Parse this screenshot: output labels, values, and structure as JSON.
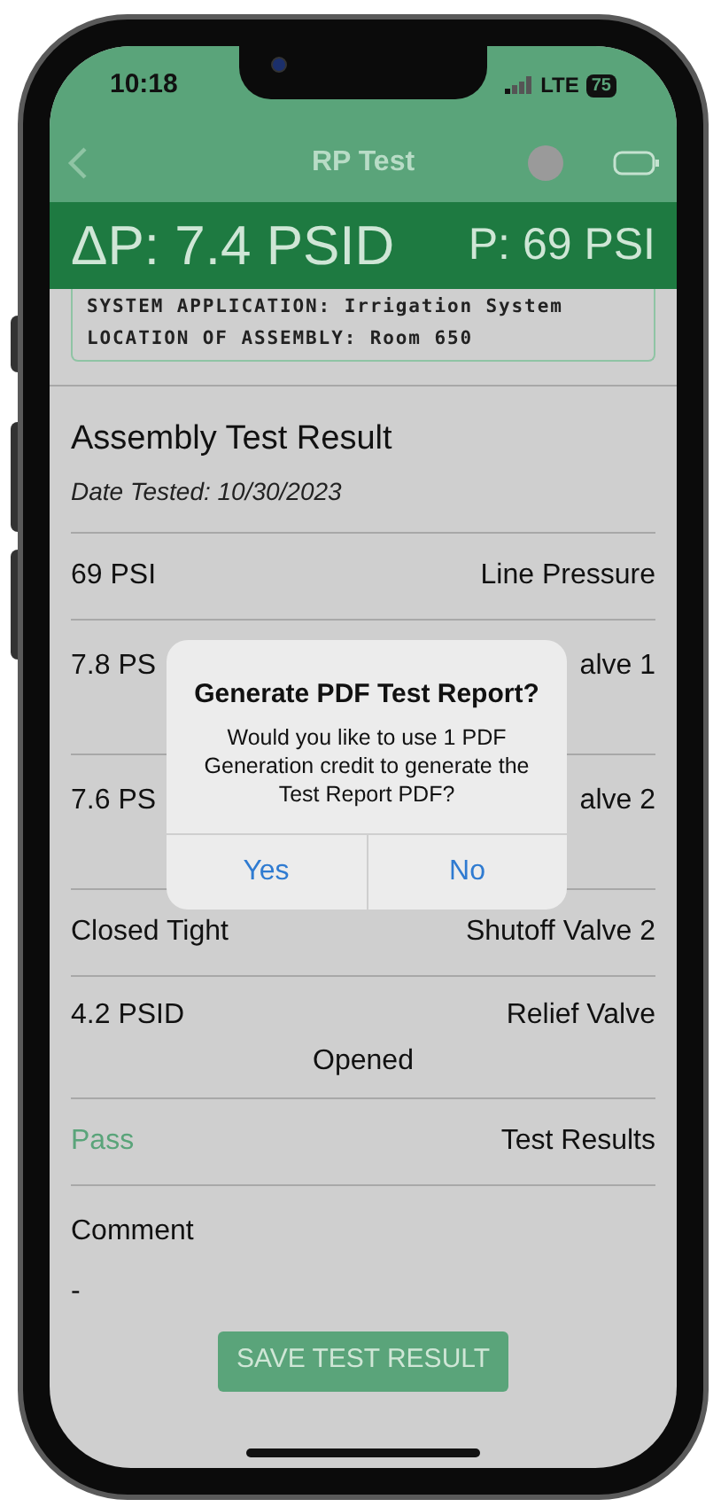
{
  "status_bar": {
    "time": "10:18",
    "network": "LTE",
    "battery": "75"
  },
  "nav": {
    "title": "RP Test"
  },
  "pressure_bar": {
    "differential": "ΔP: 7.4 PSID",
    "line": "P: 69 PSI"
  },
  "info_card": {
    "lines": [
      "SYSTEM APPLICATION: Irrigation System",
      "LOCATION OF ASSEMBLY: Room 650"
    ]
  },
  "result": {
    "title": "Assembly Test Result",
    "date": "Date Tested: 10/30/2023"
  },
  "rows": [
    {
      "kind": "plain",
      "value": "69 PSI",
      "label": "Line Pressure"
    },
    {
      "kind": "tall",
      "value": "7.8 PS",
      "label": "alve 1"
    },
    {
      "kind": "tall",
      "value": "7.6 PS",
      "label": "alve 2"
    },
    {
      "kind": "plain",
      "value": "Closed Tight",
      "label": "Shutoff Valve 2"
    },
    {
      "kind": "plain",
      "value": "4.2 PSID",
      "label": "Relief Valve",
      "note": "Opened"
    },
    {
      "kind": "result",
      "value": "Pass",
      "label": "Test Results"
    }
  ],
  "comment": {
    "label": "Comment",
    "value": "-"
  },
  "save_button": "SAVE TEST RESULT",
  "dialog": {
    "title": "Generate PDF Test Report?",
    "message": "Would you like to use 1 PDF Generation credit to generate the Test Report PDF?",
    "buttons": [
      "Yes",
      "No"
    ]
  }
}
